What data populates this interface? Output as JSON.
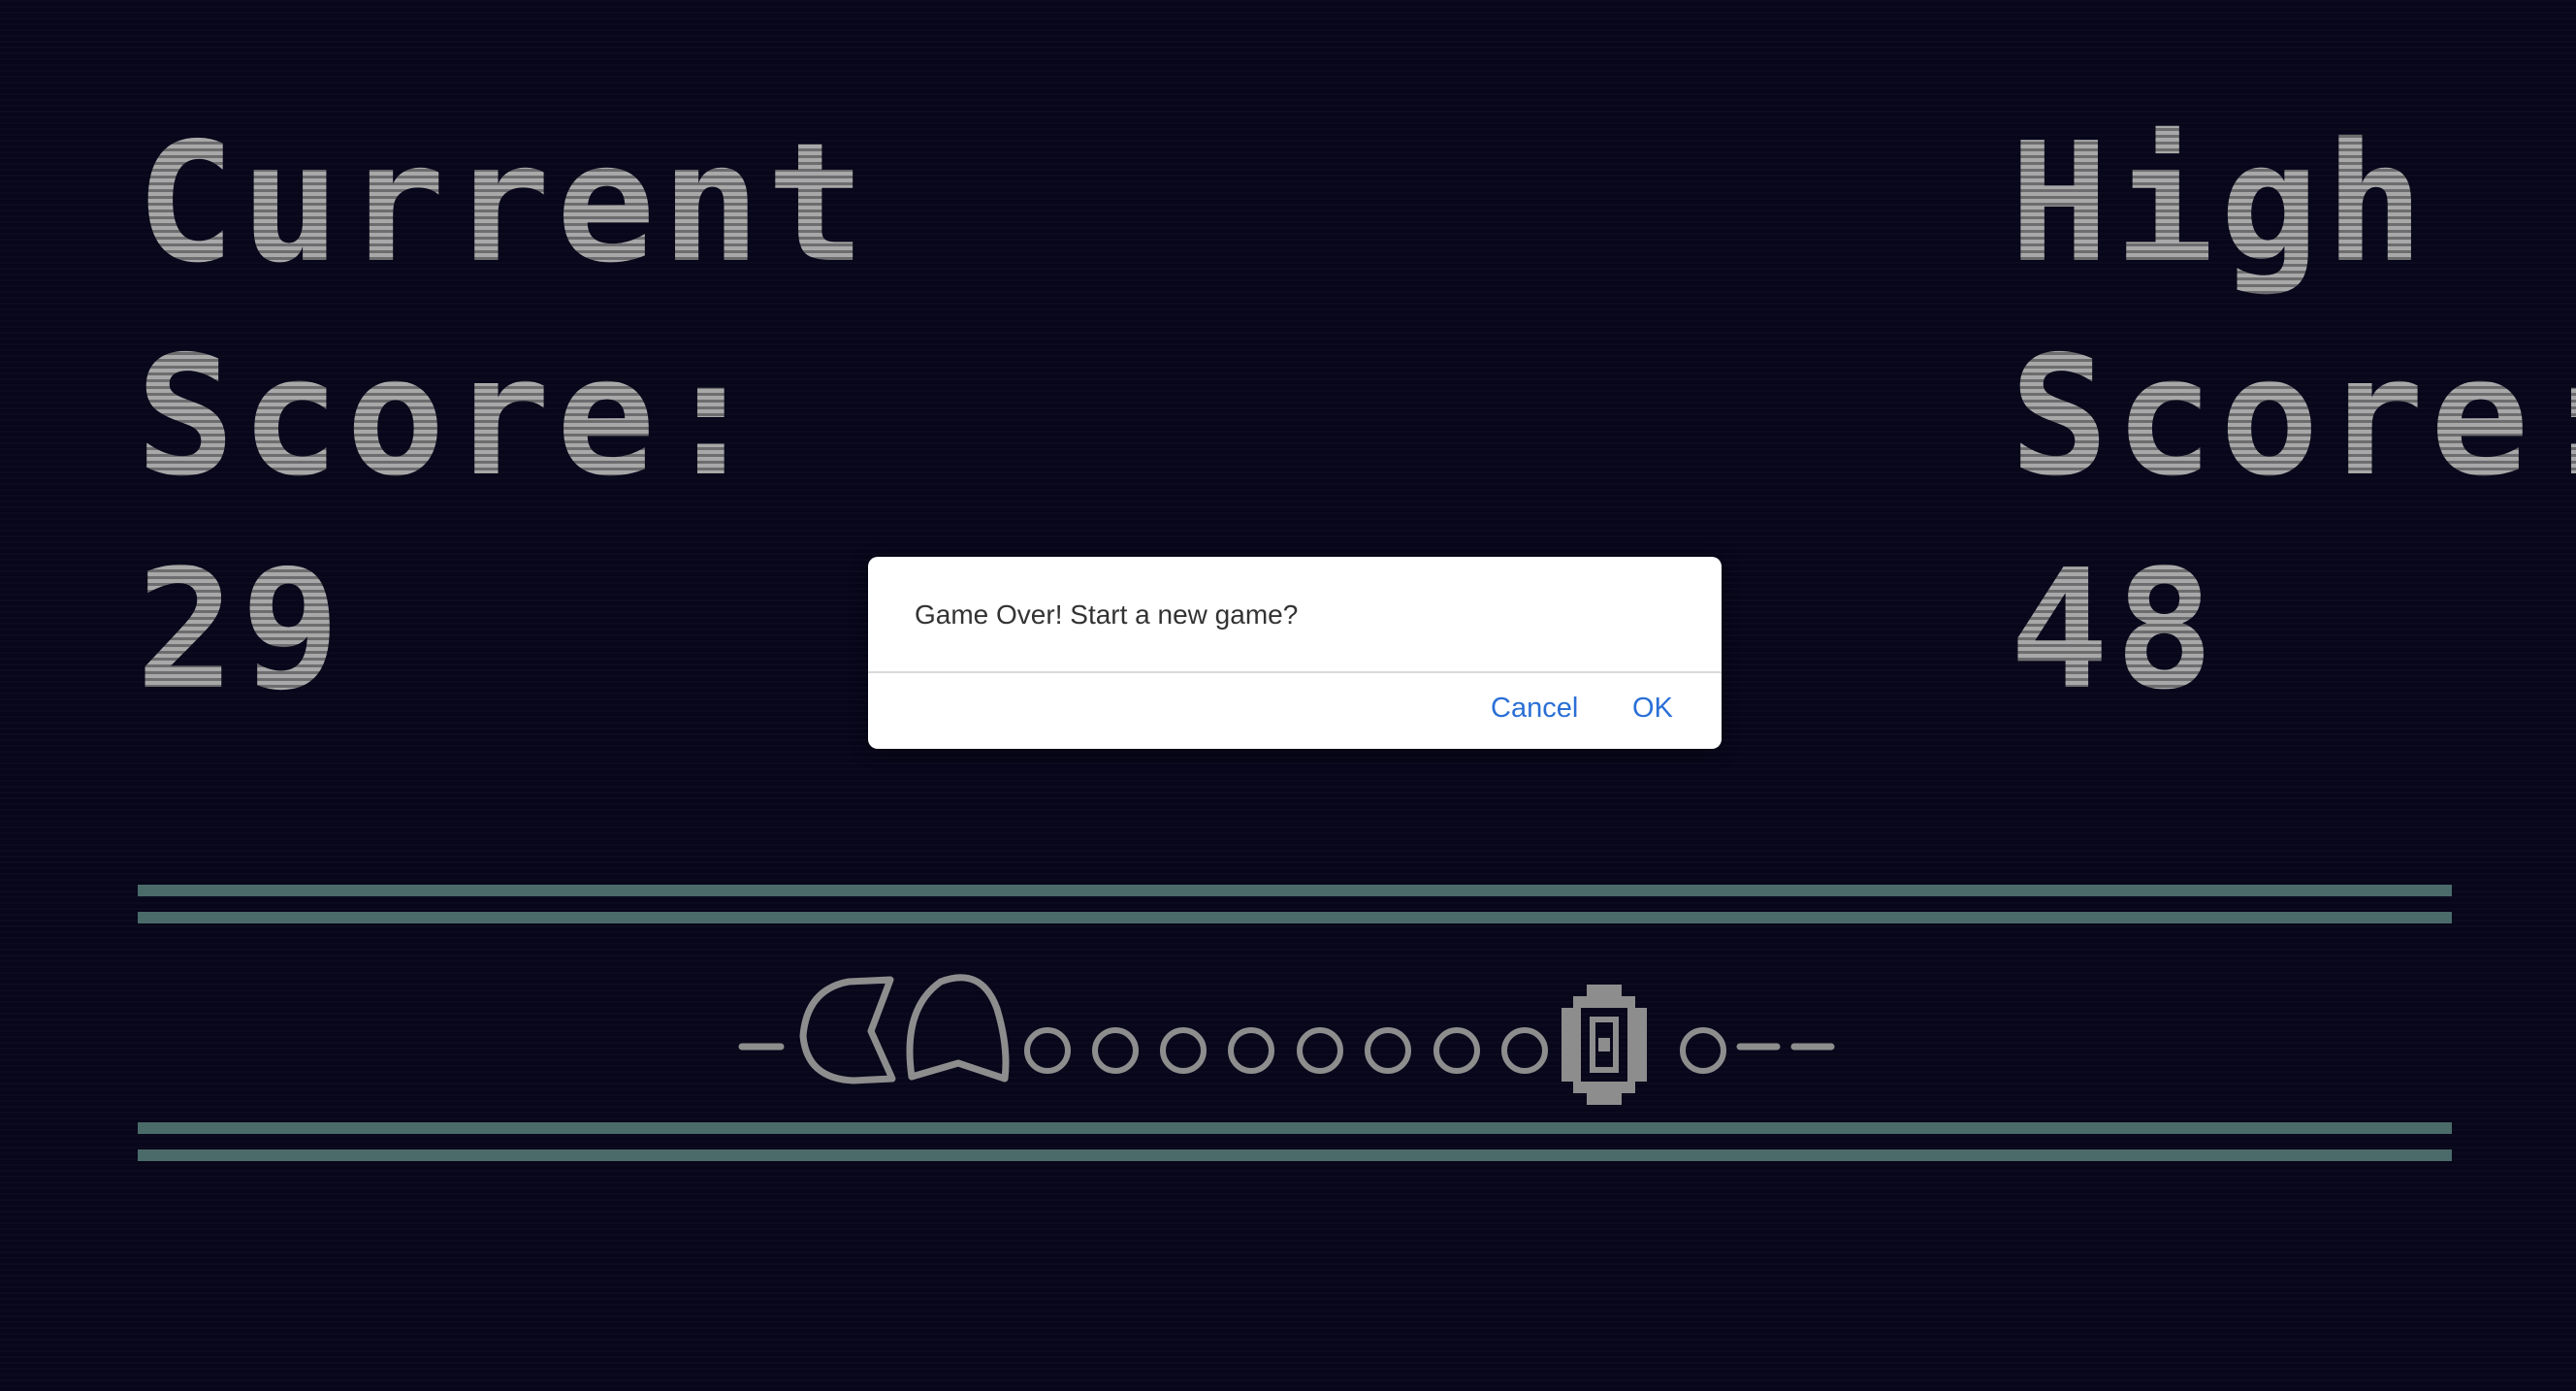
{
  "scoreboard": {
    "current": {
      "label_line1": "Current",
      "label_line2": "Score:",
      "value": "29"
    },
    "high": {
      "label_line1": "High",
      "label_line2": "Score:",
      "value": "48"
    }
  },
  "dialog": {
    "message": "Game Over! Start a new game?",
    "cancel_label": "Cancel",
    "ok_label": "OK"
  },
  "colors": {
    "background": "#07061a",
    "rail": "#4b6a6a",
    "sprite": "#8e8d8e",
    "link": "#2a6fd6"
  },
  "board": {
    "pellets_left_of_power": 8,
    "pellets_right_of_power": 1,
    "icons": [
      "pacman-icon",
      "ghost-icon",
      "pellet-icon",
      "power-pellet-icon"
    ]
  }
}
